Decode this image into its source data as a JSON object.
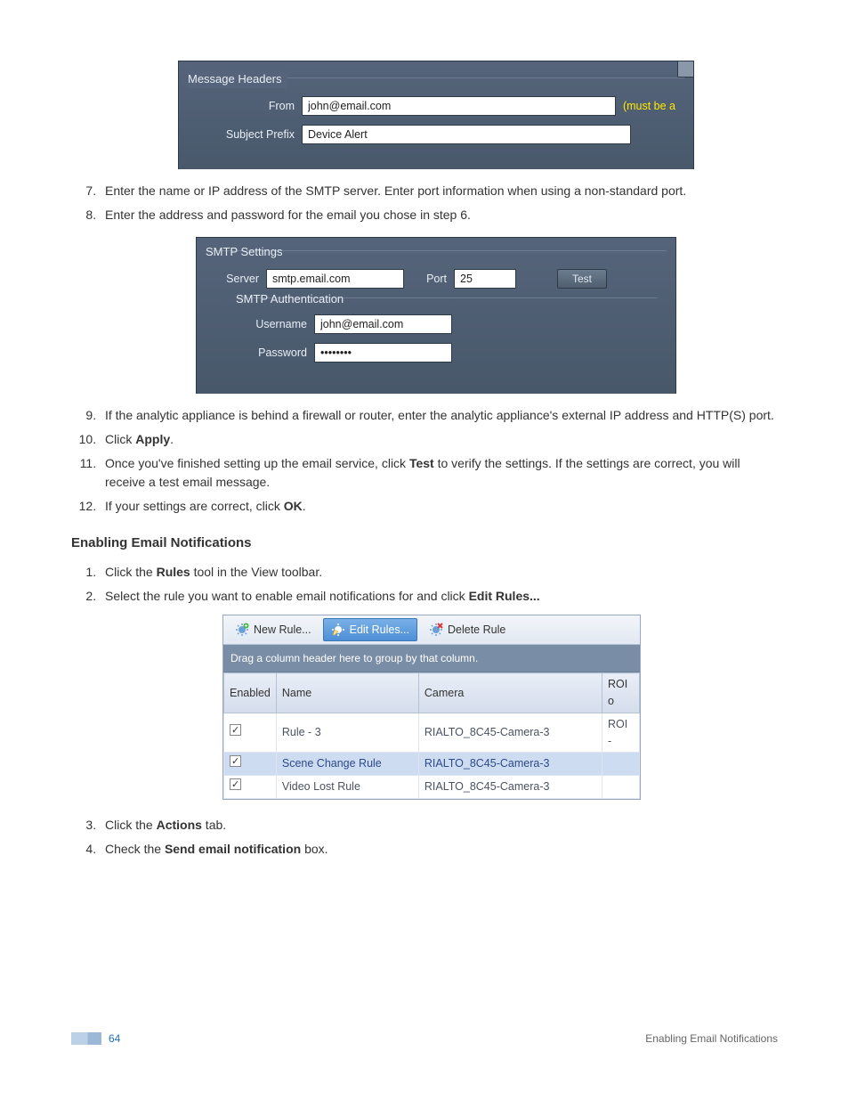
{
  "fig1": {
    "group_title": "Message Headers",
    "from_label": "From",
    "from_value": "john@email.com",
    "from_hint": "(must be a",
    "subject_label": "Subject Prefix",
    "subject_value": "Device Alert"
  },
  "steps_a": {
    "s7": "Enter the name or IP address of the SMTP server. Enter port information when using a non-standard port.",
    "s8": "Enter the address and password for the email you chose in step 6."
  },
  "fig2": {
    "group_title": "SMTP Settings",
    "server_label": "Server",
    "server_value": "smtp.email.com",
    "port_label": "Port",
    "port_value": "25",
    "test_btn": "Test",
    "auth_group": "SMTP Authentication",
    "user_label": "Username",
    "user_value": "john@email.com",
    "pass_label": "Password",
    "pass_value": "••••••••"
  },
  "steps_b": {
    "s9": "If the analytic appliance is behind a firewall or router, enter the analytic appliance's external IP address and HTTP(S) port.",
    "s10_pre": "Click ",
    "s10_b": "Apply",
    "s10_post": ".",
    "s11_pre": "Once you've finished setting up the email service, click ",
    "s11_b": "Test",
    "s11_post": " to verify the settings. If the settings are correct, you will receive a test email message.",
    "s12_pre": "If your settings are correct, click ",
    "s12_b": "OK",
    "s12_post": "."
  },
  "section_heading": "Enabling Email Notifications",
  "steps_c": {
    "s1_pre": "Click the ",
    "s1_b": "Rules",
    "s1_post": " tool in the View toolbar.",
    "s2_pre": "Select the rule you want to enable email notifications for and click ",
    "s2_b": "Edit Rules...",
    "s2_post": ""
  },
  "rules_toolbar": {
    "new_rule": "New Rule...",
    "edit_rules": "Edit Rules...",
    "delete_rule": "Delete Rule"
  },
  "rules_group_hint": "Drag a column header here to group by that column.",
  "rules_columns": {
    "c1": "Enabled",
    "c2": "Name",
    "c3": "Camera",
    "c4": "ROI o"
  },
  "rules_rows": [
    {
      "enabled": true,
      "name": "Rule - 3",
      "camera": "RIALTO_8C45-Camera-3",
      "roi": "ROI -",
      "selected": false
    },
    {
      "enabled": true,
      "name": "Scene Change Rule",
      "camera": "RIALTO_8C45-Camera-3",
      "roi": "",
      "selected": true
    },
    {
      "enabled": true,
      "name": "Video Lost Rule",
      "camera": "RIALTO_8C45-Camera-3",
      "roi": "",
      "selected": false
    }
  ],
  "steps_d": {
    "s3_pre": "Click the ",
    "s3_b": "Actions",
    "s3_post": " tab.",
    "s4_pre": "Check the ",
    "s4_b": "Send email notification",
    "s4_post": " box."
  },
  "footer": {
    "page_number": "64",
    "section": "Enabling Email Notifications"
  }
}
